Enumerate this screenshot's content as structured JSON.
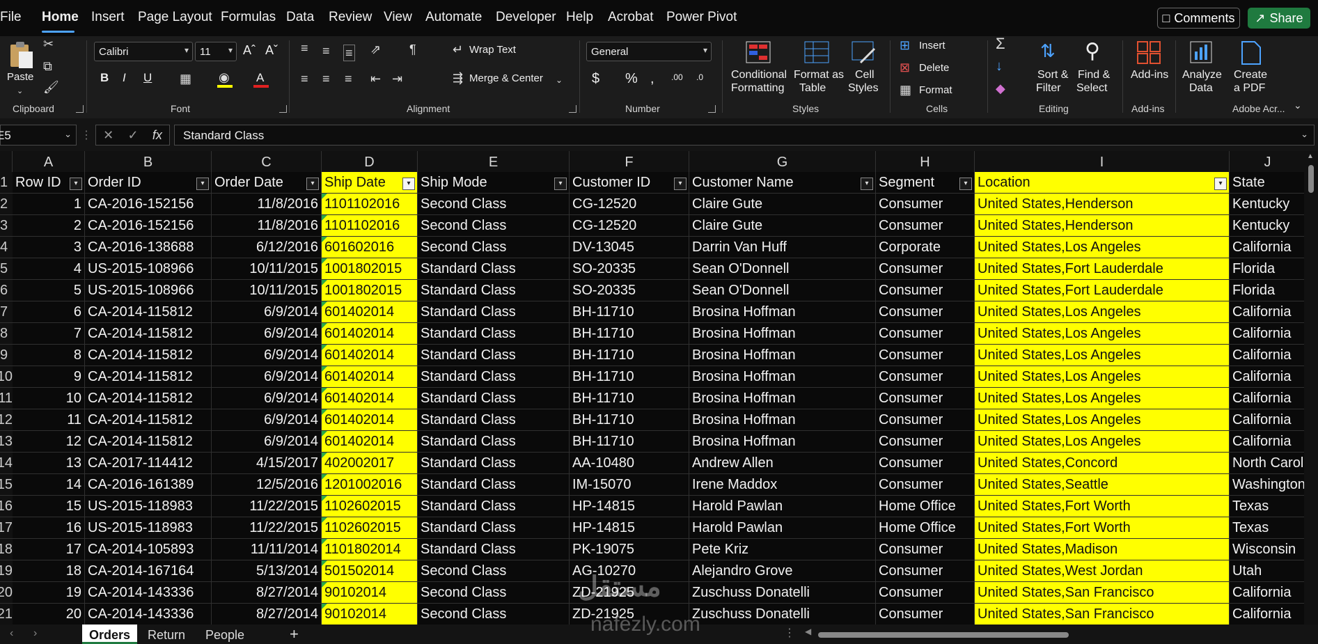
{
  "menu": {
    "tabs": [
      "File",
      "Home",
      "Insert",
      "Page Layout",
      "Formulas",
      "Data",
      "Review",
      "View",
      "Automate",
      "Developer",
      "Help",
      "Acrobat",
      "Power Pivot"
    ],
    "comments": "Comments",
    "share": "Share"
  },
  "ribbon": {
    "paste": "Paste",
    "font_name": "Calibri",
    "font_size": "11",
    "wrap_text": "Wrap Text",
    "merge_center": "Merge & Center",
    "number_format": "General",
    "conditional_formatting": [
      "Conditional",
      "Formatting"
    ],
    "format_as_table": [
      "Format as",
      "Table"
    ],
    "cell_styles": [
      "Cell",
      "Styles"
    ],
    "insert": "Insert",
    "delete": "Delete",
    "format": "Format",
    "sort_filter": [
      "Sort &",
      "Filter"
    ],
    "find_select": [
      "Find &",
      "Select"
    ],
    "addins": "Add-ins",
    "analyze_data": [
      "Analyze",
      "Data"
    ],
    "create_pdf": [
      "Create",
      "a PDF"
    ],
    "groups": [
      "Clipboard",
      "Font",
      "Alignment",
      "Number",
      "Styles",
      "Cells",
      "Editing",
      "Add-ins",
      "Adobe Acr..."
    ]
  },
  "formula_bar": {
    "name_box": "E5",
    "formula": "Standard Class"
  },
  "columns": [
    "A",
    "B",
    "C",
    "D",
    "E",
    "F",
    "G",
    "H",
    "I",
    "J"
  ],
  "headers": [
    "Row ID",
    "Order ID",
    "Order Date",
    "Ship Date",
    "Ship Mode",
    "Customer ID",
    "Customer Name",
    "Segment",
    "Location",
    "State"
  ],
  "row_numbers": [
    "1",
    "2",
    "3",
    "4",
    "5",
    "6",
    "7",
    "8",
    "9",
    "10",
    "11",
    "12",
    "13",
    "14",
    "15",
    "16",
    "17",
    "18",
    "19",
    "20",
    "21"
  ],
  "rows": [
    [
      "1",
      "CA-2016-152156",
      "11/8/2016",
      "1101102016",
      "Second Class",
      "CG-12520",
      "Claire Gute",
      "Consumer",
      "United States,Henderson",
      "Kentucky"
    ],
    [
      "2",
      "CA-2016-152156",
      "11/8/2016",
      "1101102016",
      "Second Class",
      "CG-12520",
      "Claire Gute",
      "Consumer",
      "United States,Henderson",
      "Kentucky"
    ],
    [
      "3",
      "CA-2016-138688",
      "6/12/2016",
      "601602016",
      "Second Class",
      "DV-13045",
      "Darrin Van Huff",
      "Corporate",
      "United States,Los Angeles",
      "California"
    ],
    [
      "4",
      "US-2015-108966",
      "10/11/2015",
      "1001802015",
      "Standard Class",
      "SO-20335",
      "Sean O'Donnell",
      "Consumer",
      "United States,Fort Lauderdale",
      "Florida"
    ],
    [
      "5",
      "US-2015-108966",
      "10/11/2015",
      "1001802015",
      "Standard Class",
      "SO-20335",
      "Sean O'Donnell",
      "Consumer",
      "United States,Fort Lauderdale",
      "Florida"
    ],
    [
      "6",
      "CA-2014-115812",
      "6/9/2014",
      "601402014",
      "Standard Class",
      "BH-11710",
      "Brosina Hoffman",
      "Consumer",
      "United States,Los Angeles",
      "California"
    ],
    [
      "7",
      "CA-2014-115812",
      "6/9/2014",
      "601402014",
      "Standard Class",
      "BH-11710",
      "Brosina Hoffman",
      "Consumer",
      "United States,Los Angeles",
      "California"
    ],
    [
      "8",
      "CA-2014-115812",
      "6/9/2014",
      "601402014",
      "Standard Class",
      "BH-11710",
      "Brosina Hoffman",
      "Consumer",
      "United States,Los Angeles",
      "California"
    ],
    [
      "9",
      "CA-2014-115812",
      "6/9/2014",
      "601402014",
      "Standard Class",
      "BH-11710",
      "Brosina Hoffman",
      "Consumer",
      "United States,Los Angeles",
      "California"
    ],
    [
      "10",
      "CA-2014-115812",
      "6/9/2014",
      "601402014",
      "Standard Class",
      "BH-11710",
      "Brosina Hoffman",
      "Consumer",
      "United States,Los Angeles",
      "California"
    ],
    [
      "11",
      "CA-2014-115812",
      "6/9/2014",
      "601402014",
      "Standard Class",
      "BH-11710",
      "Brosina Hoffman",
      "Consumer",
      "United States,Los Angeles",
      "California"
    ],
    [
      "12",
      "CA-2014-115812",
      "6/9/2014",
      "601402014",
      "Standard Class",
      "BH-11710",
      "Brosina Hoffman",
      "Consumer",
      "United States,Los Angeles",
      "California"
    ],
    [
      "13",
      "CA-2017-114412",
      "4/15/2017",
      "402002017",
      "Standard Class",
      "AA-10480",
      "Andrew Allen",
      "Consumer",
      "United States,Concord",
      "North Carolina"
    ],
    [
      "14",
      "CA-2016-161389",
      "12/5/2016",
      "1201002016",
      "Standard Class",
      "IM-15070",
      "Irene Maddox",
      "Consumer",
      "United States,Seattle",
      "Washington"
    ],
    [
      "15",
      "US-2015-118983",
      "11/22/2015",
      "1102602015",
      "Standard Class",
      "HP-14815",
      "Harold Pawlan",
      "Home Office",
      "United States,Fort Worth",
      "Texas"
    ],
    [
      "16",
      "US-2015-118983",
      "11/22/2015",
      "1102602015",
      "Standard Class",
      "HP-14815",
      "Harold Pawlan",
      "Home Office",
      "United States,Fort Worth",
      "Texas"
    ],
    [
      "17",
      "CA-2014-105893",
      "11/11/2014",
      "1101802014",
      "Standard Class",
      "PK-19075",
      "Pete Kriz",
      "Consumer",
      "United States,Madison",
      "Wisconsin"
    ],
    [
      "18",
      "CA-2014-167164",
      "5/13/2014",
      "501502014",
      "Second Class",
      "AG-10270",
      "Alejandro Grove",
      "Consumer",
      "United States,West Jordan",
      "Utah"
    ],
    [
      "19",
      "CA-2014-143336",
      "8/27/2014",
      "90102014",
      "Second Class",
      "ZD-21925",
      "Zuschuss Donatelli",
      "Consumer",
      "United States,San Francisco",
      "California"
    ],
    [
      "20",
      "CA-2014-143336",
      "8/27/2014",
      "90102014",
      "Second Class",
      "ZD-21925",
      "Zuschuss Donatelli",
      "Consumer",
      "United States,San Francisco",
      "California"
    ]
  ],
  "sheets": [
    "Orders",
    "Return",
    "People"
  ],
  "watermark": "nafezly.com",
  "colors": {
    "highlight": "#ffff00",
    "accent": "#4da3ff",
    "share": "#1f7a3f"
  }
}
